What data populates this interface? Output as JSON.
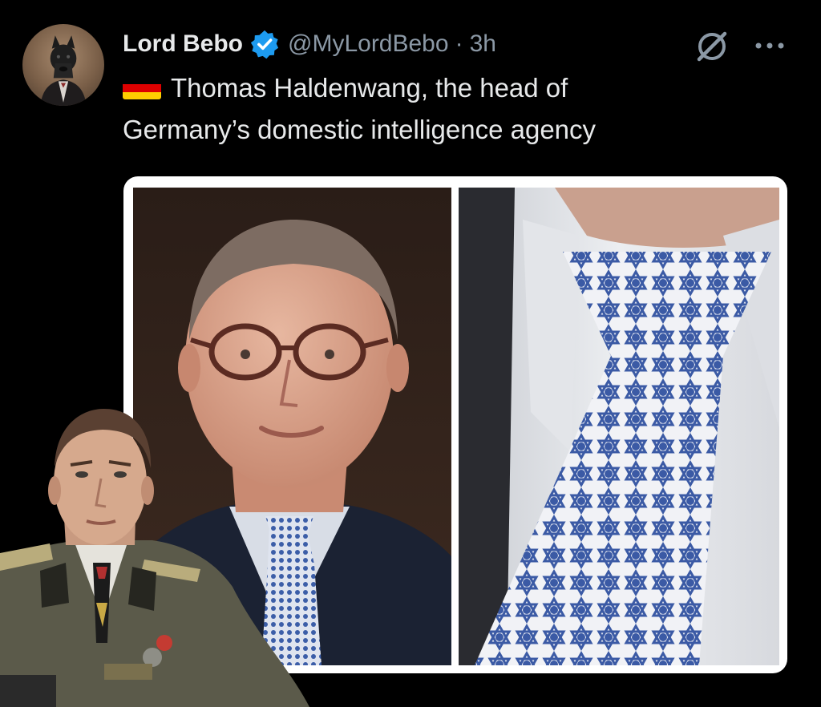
{
  "post": {
    "author_name": "Lord Bebo",
    "handle": "@MyLordBebo",
    "separator": "·",
    "time": "3h",
    "verified": true,
    "text_line1": "Thomas Haldenwang, the head of",
    "text_line2": "Germany’s domestic intelligence agency",
    "flag": "germany-flag-emoji"
  },
  "icons": {
    "verified": "verified-badge-icon",
    "grok": "grok-icon",
    "more": "more-options-icon"
  },
  "colors": {
    "background": "#000000",
    "text": "#e7e9ea",
    "secondary_text": "#8b98a5",
    "verified_blue": "#1d9bf0"
  },
  "media": {
    "images": [
      {
        "name": "man-in-glasses-photo"
      },
      {
        "name": "patterned-tie-closeup-photo"
      }
    ]
  },
  "overlay": {
    "name": "uniformed-officer-cutout"
  }
}
